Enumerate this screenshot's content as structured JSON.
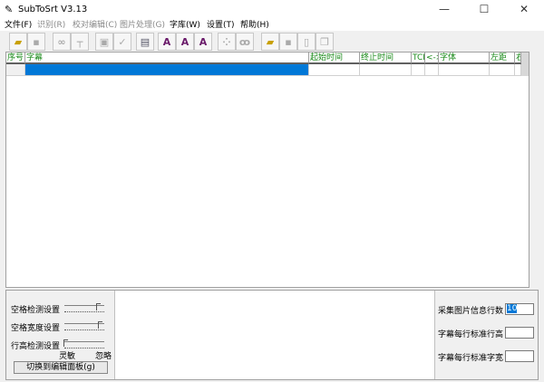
{
  "window": {
    "title": "SubToSrt V3.13",
    "minimize": "—",
    "maximize": "☐",
    "close": "✕"
  },
  "menu": [
    {
      "label": "文件(F)",
      "enabled": true
    },
    {
      "label": "识别(R)",
      "enabled": false
    },
    {
      "label": "校对编辑(C)",
      "enabled": false
    },
    {
      "label": "图片处理(G)",
      "enabled": false
    },
    {
      "label": "字库(W)",
      "enabled": true
    },
    {
      "label": "设置(T)",
      "enabled": true
    },
    {
      "label": "帮助(H)",
      "enabled": true
    }
  ],
  "toolbar": [
    {
      "icon": "open-folder-icon",
      "enabled": true
    },
    {
      "icon": "save-icon",
      "enabled": false
    },
    {
      "icon": "glasses-icon",
      "enabled": false
    },
    {
      "icon": "ruler-icon",
      "enabled": false
    },
    {
      "icon": "image-icon",
      "enabled": false
    },
    {
      "icon": "check-icon",
      "enabled": false
    },
    {
      "icon": "settings-doc-icon",
      "enabled": true
    },
    {
      "icon": "font-icon",
      "enabled": true
    },
    {
      "icon": "font-add-icon",
      "enabled": true
    },
    {
      "icon": "font-remove-icon",
      "enabled": true
    },
    {
      "icon": "select-dots-icon",
      "enabled": false
    },
    {
      "icon": "binoculars-icon",
      "enabled": false
    },
    {
      "icon": "open-folder-icon",
      "enabled": true
    },
    {
      "icon": "save-icon",
      "enabled": false
    },
    {
      "icon": "page-icon",
      "enabled": false
    },
    {
      "icon": "copy-icon",
      "enabled": false
    }
  ],
  "grid": {
    "columns": [
      "序号",
      "字幕",
      "起始时间",
      "终止时间",
      "TCP",
      "<->",
      "字体",
      "左距",
      "右"
    ],
    "selected_row": 0
  },
  "colors": {
    "selection": "#0078d7",
    "header_text": "#1a8a1a"
  },
  "left_panel": {
    "sliders": [
      {
        "label": "空格检测设置",
        "value": 0.9
      },
      {
        "label": "空格宽度设置",
        "value": 0.95
      },
      {
        "label": "行高检测设置",
        "value": 0.0
      }
    ],
    "min_label": "灵敏",
    "max_label": "忽略",
    "switch_button": "切换到编辑面板(g)"
  },
  "right_panel": {
    "fields": [
      {
        "label": "采集图片信息行数",
        "value": "10"
      },
      {
        "label": "字幕每行标准行高",
        "value": ""
      },
      {
        "label": "字幕每行标准字宽",
        "value": ""
      }
    ]
  }
}
